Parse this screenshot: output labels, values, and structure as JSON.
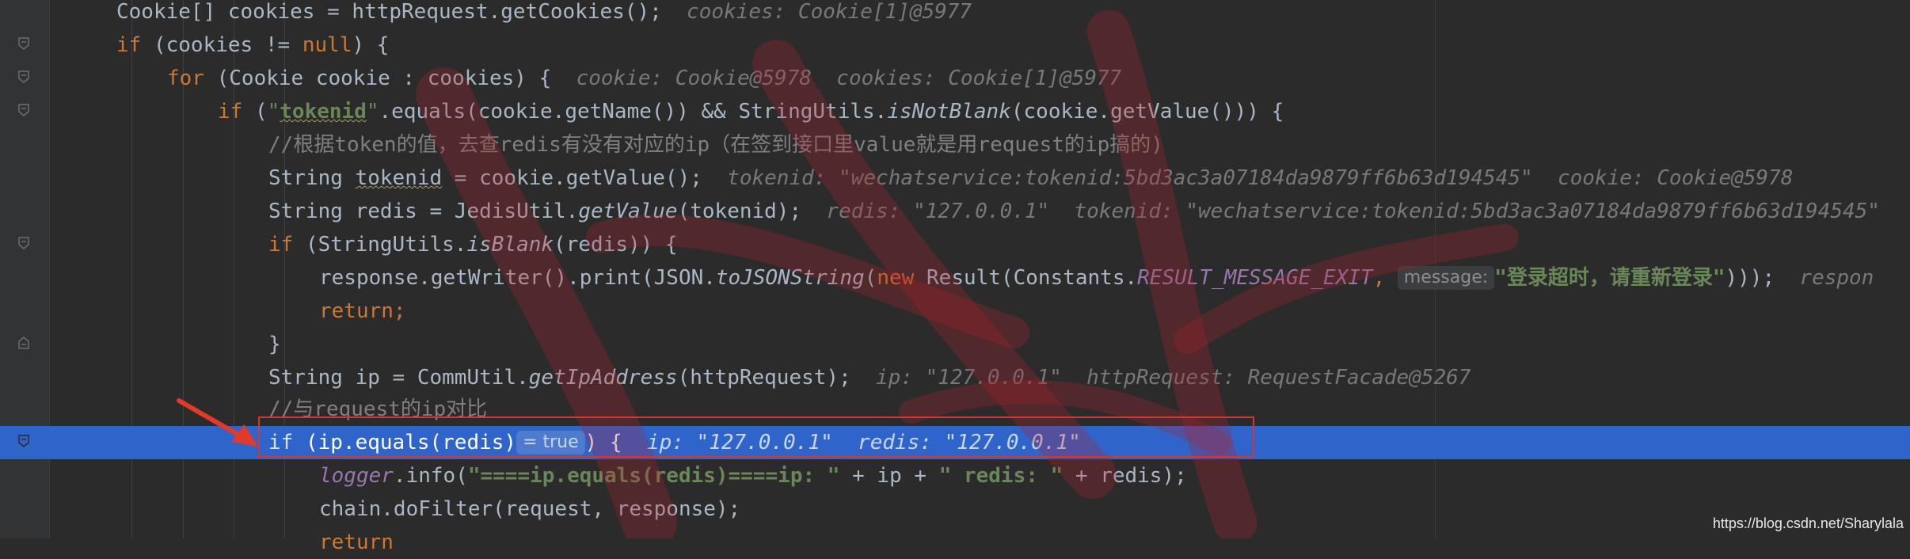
{
  "lines": [
    {
      "id": "cookies-decl",
      "segments": [
        {
          "t": "Cookie[] cookies = httpRequest.getCookies();",
          "c": "d"
        },
        {
          "t": "  cookies: Cookie[1]@5977",
          "c": "h"
        }
      ]
    },
    {
      "id": "if-cookies-null",
      "segments": [
        {
          "t": "if",
          "c": "k"
        },
        {
          "t": " (cookies != ",
          "c": "d"
        },
        {
          "t": "null",
          "c": "k"
        },
        {
          "t": ") {",
          "c": "d"
        }
      ]
    },
    {
      "id": "for-cookie",
      "segments": [
        {
          "t": "for",
          "c": "k"
        },
        {
          "t": " (Cookie cookie : cookies) {",
          "c": "d"
        },
        {
          "t": "  cookie: Cookie@5978  cookies: Cookie[1]@5977",
          "c": "h"
        }
      ]
    },
    {
      "id": "if-tokenid",
      "segments": [
        {
          "t": "if",
          "c": "k"
        },
        {
          "t": " (",
          "c": "d"
        },
        {
          "t": "\"",
          "c": "s"
        },
        {
          "t": "tokenid",
          "c": "sb wavy"
        },
        {
          "t": "\"",
          "c": "s"
        },
        {
          "t": ".equals(cookie.getName()) && StringUtils.",
          "c": "d"
        },
        {
          "t": "isNotBlank",
          "c": "m"
        },
        {
          "t": "(cookie.getValue())) {",
          "c": "d"
        }
      ]
    },
    {
      "id": "comment-token",
      "segments": [
        {
          "t": "//根据token的值，去查redis有没有对应的ip（在签到接口里value就是用request的ip搞的)",
          "c": "c"
        }
      ]
    },
    {
      "id": "tokenid-decl",
      "segments": [
        {
          "t": "String ",
          "c": "d"
        },
        {
          "t": "tokenid",
          "c": "d wavy"
        },
        {
          "t": " = cookie.getValue();",
          "c": "d"
        },
        {
          "t": "  tokenid: \"wechatservice:tokenid:5bd3ac3a07184da9879ff6b63d194545\"  cookie: Cookie@5978",
          "c": "h"
        }
      ]
    },
    {
      "id": "redis-decl",
      "segments": [
        {
          "t": "String redis = JedisUtil.",
          "c": "d"
        },
        {
          "t": "getValue",
          "c": "m"
        },
        {
          "t": "(tokenid);",
          "c": "d"
        },
        {
          "t": "  redis: \"127.0.0.1\"  tokenid: \"wechatservice:tokenid:5bd3ac3a07184da9879ff6b63d194545\"",
          "c": "h"
        }
      ]
    },
    {
      "id": "if-blank",
      "segments": [
        {
          "t": "if",
          "c": "k"
        },
        {
          "t": " (StringUtils.",
          "c": "d"
        },
        {
          "t": "isBlank",
          "c": "m"
        },
        {
          "t": "(redis)) {",
          "c": "d"
        }
      ]
    },
    {
      "id": "print-response",
      "segments": [
        {
          "t": "response.getWriter().print(JSON.",
          "c": "d"
        },
        {
          "t": "toJSONString",
          "c": "m"
        },
        {
          "t": "(",
          "c": "d"
        },
        {
          "t": "new",
          "c": "k"
        },
        {
          "t": " Result(Constants.",
          "c": "d"
        },
        {
          "t": "RESULT_MESSAGE_EXIT",
          "c": "f"
        },
        {
          "t": ", ",
          "c": "k"
        },
        {
          "pill": "message:"
        },
        {
          "t": "\"登录超时，请重新登录\"",
          "c": "sb"
        },
        {
          "t": ")));",
          "c": "d"
        },
        {
          "t": "  respon",
          "c": "h"
        }
      ]
    },
    {
      "id": "return",
      "segments": [
        {
          "t": "return",
          "c": "k"
        },
        {
          "t": ";",
          "c": "k"
        }
      ]
    },
    {
      "id": "close-brace",
      "segments": [
        {
          "t": "}",
          "c": "d"
        }
      ]
    },
    {
      "id": "ip-decl",
      "segments": [
        {
          "t": "String ip = CommUtil.",
          "c": "d"
        },
        {
          "t": "getIpAddress",
          "c": "m"
        },
        {
          "t": "(httpRequest);",
          "c": "d"
        },
        {
          "t": "  ip: \"127.0.0.1\"  httpRequest: RequestFacade@5267",
          "c": "h"
        }
      ]
    },
    {
      "id": "comment-compare",
      "segments": [
        {
          "t": "//与request的ip对比",
          "c": "c"
        }
      ]
    },
    {
      "id": "if-ip-equals",
      "segments": [
        {
          "t": "if",
          "c": "k"
        },
        {
          "t": " (ip.equals(redis)",
          "c": "d"
        },
        {
          "pill": "= true"
        },
        {
          "t": ") {",
          "c": "d"
        },
        {
          "t": "  ip: \"127.0.0.1\"  redis: \"127.0.0.1\"",
          "c": "h"
        }
      ]
    },
    {
      "id": "logger-info",
      "segments": [
        {
          "t": "logger",
          "c": "f"
        },
        {
          "t": ".info(",
          "c": "d"
        },
        {
          "t": "\"====ip.equals(redis)====ip: \"",
          "c": "sb"
        },
        {
          "t": " + ip + ",
          "c": "d"
        },
        {
          "t": "\" redis: \"",
          "c": "sb"
        },
        {
          "t": " + redis);",
          "c": "d"
        }
      ]
    },
    {
      "id": "chain-dofilter",
      "segments": [
        {
          "t": "chain.doFilter(request, response);",
          "c": "d"
        }
      ]
    },
    {
      "id": "return-partial",
      "segments": [
        {
          "t": "return",
          "c": "k"
        }
      ]
    }
  ],
  "watermark_text": "https://blog.csdn.net/Sharylala"
}
